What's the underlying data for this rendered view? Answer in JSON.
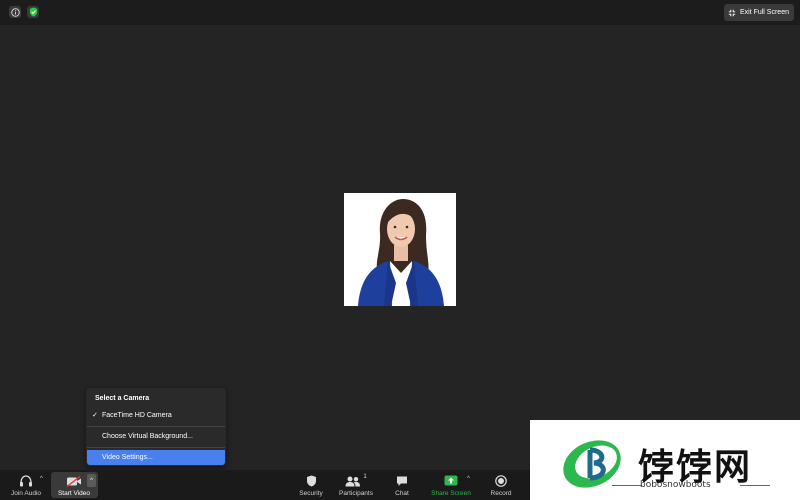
{
  "top_bar": {
    "info_icon": "info-icon",
    "security_icon": "shield-check-icon",
    "exit_fullscreen_label": "Exit Full Screen"
  },
  "camera_menu": {
    "header": "Select a Camera",
    "items": [
      {
        "label": "FaceTime HD Camera",
        "checked": true
      },
      {
        "label": "Choose Virtual Background...",
        "checked": false
      },
      {
        "label": "Video Settings...",
        "checked": false,
        "highlighted": true
      }
    ],
    "check_glyph": "✓"
  },
  "toolbar": {
    "join_audio": "Join Audio",
    "start_video": "Start Video",
    "security": "Security",
    "participants": "Participants",
    "participants_count": "1",
    "chat": "Chat",
    "share_screen": "Share Screen",
    "record": "Record"
  },
  "watermark": {
    "title": "饽饽网",
    "subtitle": "bobosnowboots"
  },
  "colors": {
    "background": "#242424",
    "toolbar": "#1a1a1a",
    "menu_highlight": "#4a7ff0",
    "share_green": "#2db84d",
    "shield_green": "#2ecc40"
  }
}
